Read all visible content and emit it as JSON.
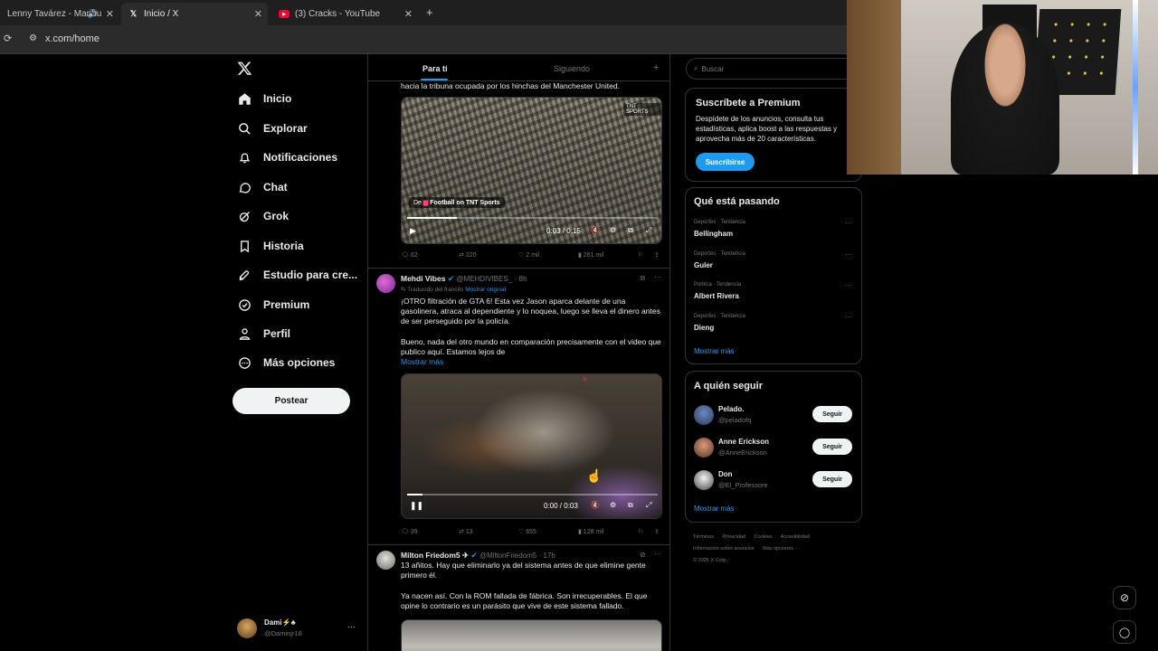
{
  "browser": {
    "tabs": [
      {
        "title": "Lenny Tavárez - Marihu",
        "icon": "music-tab-icon"
      },
      {
        "title": "Inicio / X",
        "icon": "x-logo-icon"
      },
      {
        "title": "(3) Cracks - YouTube",
        "icon": "youtube-icon"
      }
    ],
    "new_tab": "+",
    "url": "x.com/home"
  },
  "nav": {
    "items": [
      {
        "label": "Inicio",
        "icon": "home-icon"
      },
      {
        "label": "Explorar",
        "icon": "search-icon"
      },
      {
        "label": "Notificaciones",
        "icon": "bell-icon"
      },
      {
        "label": "Chat",
        "icon": "chat-icon"
      },
      {
        "label": "Grok",
        "icon": "grok-icon"
      },
      {
        "label": "Historia",
        "icon": "bookmark-icon"
      },
      {
        "label": "Estudio para cre...",
        "icon": "rocket-icon"
      },
      {
        "label": "Premium",
        "icon": "verified-icon"
      },
      {
        "label": "Perfil",
        "icon": "person-icon"
      },
      {
        "label": "Más opciones",
        "icon": "more-circle-icon"
      }
    ],
    "post_label": "Postear",
    "account": {
      "name": "Dami⚡♣",
      "handle": "@Daminjr18",
      "more": "···"
    }
  },
  "feed": {
    "tabs": [
      "Para ti",
      "Siguiendo"
    ],
    "add": "+",
    "tweet1": {
      "text_tail": "hacia la tribuna ocupada por los hinchas del Manchester United.",
      "source_label": "De",
      "source_name": "Football on TNT Sports",
      "time": "0:03 / 0:15",
      "replies": "62",
      "retweets": "220",
      "likes": "2 mil",
      "views": "261 mil"
    },
    "tweet2": {
      "author": "Mehdi Vibes",
      "handle": "@MEHDIVIBES_",
      "age": "· 8h",
      "translated": "Traducido del francés",
      "show_original": "Mostrar original",
      "text1": "¡OTRO filtración de GTA 6! Esta vez Jason aparca delante de una gasolinera, atraca al dependiente y lo noquea, luego se lleva el dinero antes de ser perseguido por la policía.",
      "text2": "Bueno, nada del otro mundo en comparación precisamente con el video que publico aquí. Estamos lejos de",
      "show_more": "Mostrar más",
      "time": "0:00 / 0:03",
      "progress": 0.06,
      "replies": "39",
      "retweets": "13",
      "likes": "655",
      "views": "128 mil"
    },
    "tweet3": {
      "author": "Milton Friedom5 ✈",
      "handle": "@MiltonFriedom5",
      "age": "· 17h",
      "text1": "13 añitos. Hay que eliminarlo ya del sistema antes de que elimine gente primero él.",
      "text2": "Ya nacen así. Con la ROM fallada de fábrica. Son irrecuperables. El que opine lo contrario es un parásito que vive de este sistema fallado."
    },
    "tweet1_progress": 0.2
  },
  "right": {
    "search_placeholder": "Buscar",
    "premium": {
      "title": "Suscríbete a Premium",
      "body": "Despídete de los anuncios, consulta tus estadísticas, aplica boost a las respuestas y aprovecha más de 20 características.",
      "button": "Suscribirse"
    },
    "trends": {
      "title": "Qué está pasando",
      "items": [
        {
          "category": "Deportes · Tendencia",
          "name": "Bellingham"
        },
        {
          "category": "Deportes · Tendencia",
          "name": "Guler"
        },
        {
          "category": "Política · Tendencia",
          "name": "Albert Rivera"
        },
        {
          "category": "Deportes · Tendencia",
          "name": "Dieng"
        }
      ],
      "show_more": "Mostrar más"
    },
    "follow": {
      "title": "A quién seguir",
      "items": [
        {
          "name": "Pelado.",
          "handle": "@peladofq",
          "button": "Seguir"
        },
        {
          "name": "Anne Erickson",
          "handle": "@AnneErickson",
          "button": "Seguir"
        },
        {
          "name": "Don",
          "handle": "@El_Professore",
          "button": "Seguir"
        }
      ],
      "show_more": "Mostrar más"
    },
    "footer": [
      "Términos",
      "Privacidad",
      "Cookies",
      "Accesibilidad",
      "Información sobre anuncios",
      "Más opciones ···",
      "© 2025 X Corp."
    ]
  },
  "colors": {
    "accent": "#1d9bf0",
    "background": "#000000",
    "border": "#2f3336"
  }
}
